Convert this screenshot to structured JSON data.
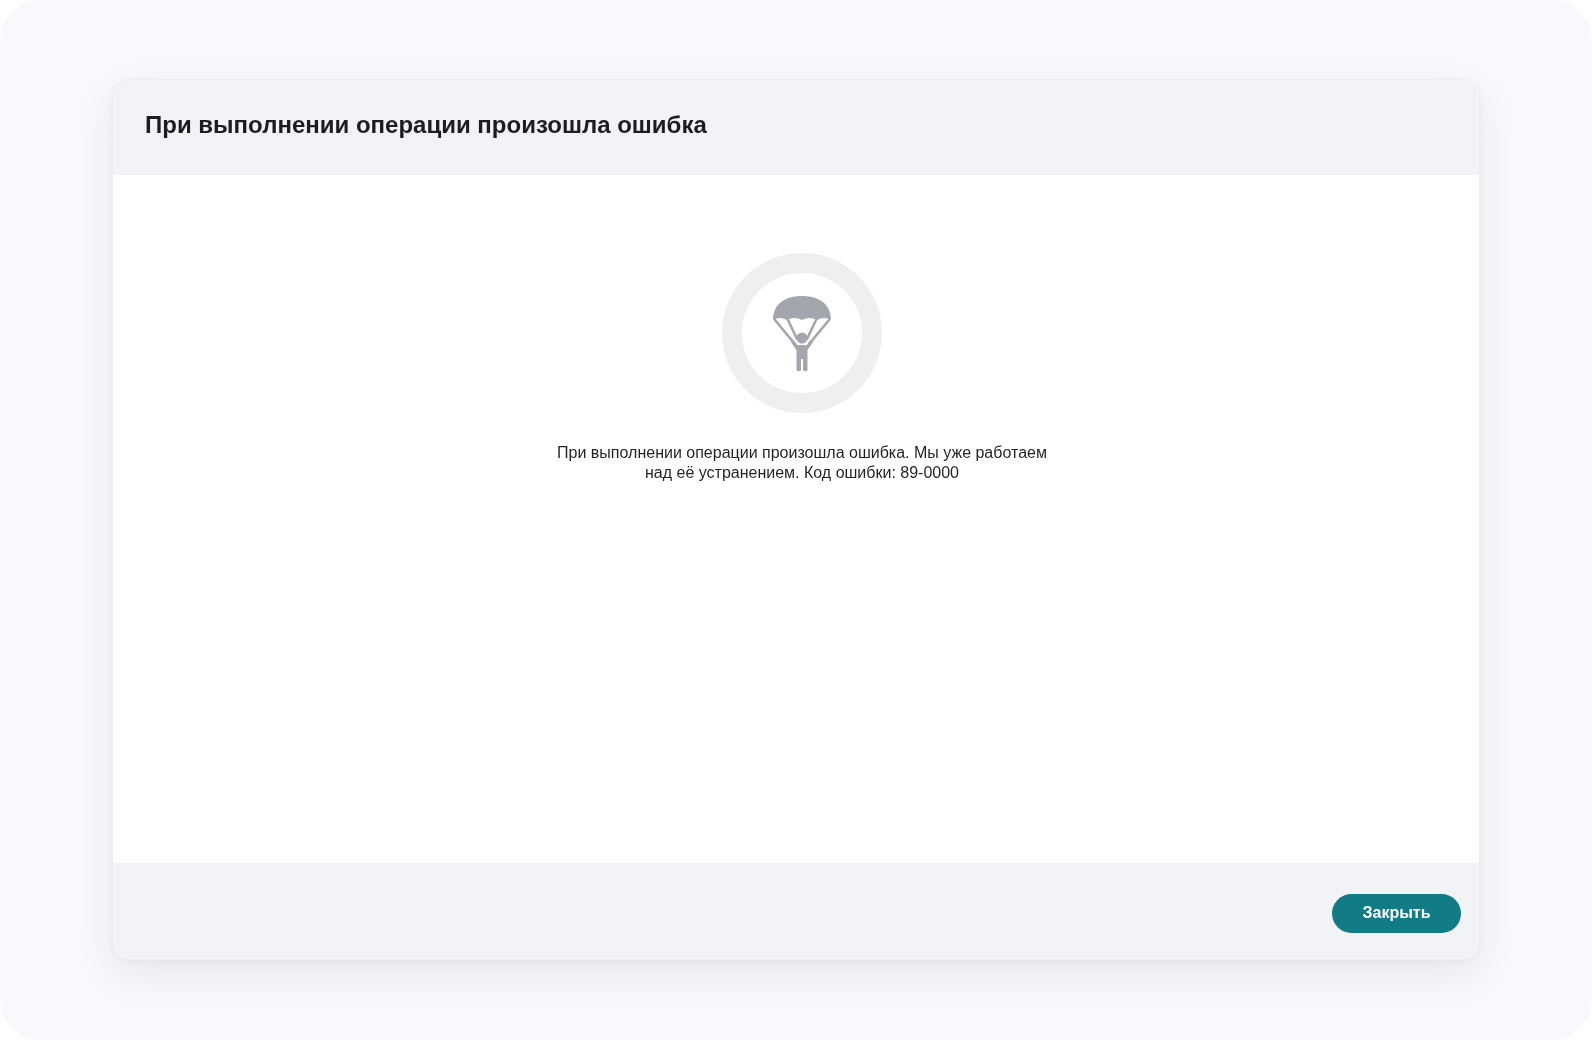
{
  "dialog": {
    "title": "При выполнении операции произошла ошибка",
    "message": "При выполнении операции произошла ошибка. Мы уже работаем над её устранением. Код ошибки: 89-0000",
    "footer": {
      "buttons": [
        {
          "label": "Закрыть",
          "kind": "primary"
        }
      ]
    }
  }
}
